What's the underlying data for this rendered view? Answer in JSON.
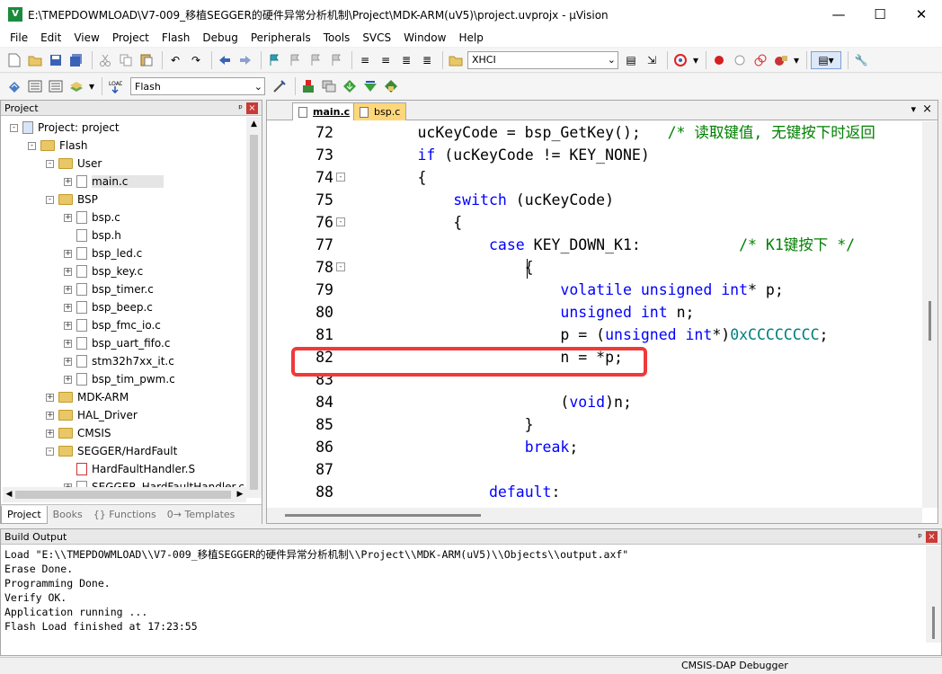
{
  "window": {
    "title": "E:\\TMEPDOWMLOAD\\V7-009_移植SEGGER的硬件异常分析机制\\Project\\MDK-ARM(uV5)\\project.uvprojx - µVision",
    "min": "—",
    "max": "☐",
    "close": "✕"
  },
  "menu": [
    "File",
    "Edit",
    "View",
    "Project",
    "Flash",
    "Debug",
    "Peripherals",
    "Tools",
    "SVCS",
    "Window",
    "Help"
  ],
  "toolbar": {
    "find_combo": "XHCI",
    "target_combo": "Flash"
  },
  "project_panel": {
    "title": "Project",
    "pin": "ᵖ",
    "close": "×",
    "tree": [
      {
        "label": "Project: project",
        "level": 0,
        "type": "root",
        "exp": "-"
      },
      {
        "label": "Flash",
        "level": 1,
        "type": "target",
        "exp": "-"
      },
      {
        "label": "User",
        "level": 2,
        "type": "folder",
        "exp": "-"
      },
      {
        "label": "main.c",
        "level": 3,
        "type": "file",
        "exp": "+"
      },
      {
        "label": "BSP",
        "level": 2,
        "type": "folder",
        "exp": "-"
      },
      {
        "label": "bsp.c",
        "level": 3,
        "type": "file",
        "exp": "+"
      },
      {
        "label": "bsp.h",
        "level": 3,
        "type": "file",
        "exp": ""
      },
      {
        "label": "bsp_led.c",
        "level": 3,
        "type": "file",
        "exp": "+"
      },
      {
        "label": "bsp_key.c",
        "level": 3,
        "type": "file",
        "exp": "+"
      },
      {
        "label": "bsp_timer.c",
        "level": 3,
        "type": "file",
        "exp": "+"
      },
      {
        "label": "bsp_beep.c",
        "level": 3,
        "type": "file",
        "exp": "+"
      },
      {
        "label": "bsp_fmc_io.c",
        "level": 3,
        "type": "file",
        "exp": "+"
      },
      {
        "label": "bsp_uart_fifo.c",
        "level": 3,
        "type": "file",
        "exp": "+"
      },
      {
        "label": "stm32h7xx_it.c",
        "level": 3,
        "type": "file",
        "exp": "+"
      },
      {
        "label": "bsp_tim_pwm.c",
        "level": 3,
        "type": "file",
        "exp": "+"
      },
      {
        "label": "MDK-ARM",
        "level": 2,
        "type": "folder",
        "exp": "+"
      },
      {
        "label": "HAL_Driver",
        "level": 2,
        "type": "folder",
        "exp": "+"
      },
      {
        "label": "CMSIS",
        "level": 2,
        "type": "folder",
        "exp": "+"
      },
      {
        "label": "SEGGER/HardFault",
        "level": 2,
        "type": "folder",
        "exp": "-"
      },
      {
        "label": "HardFaultHandler.S",
        "level": 3,
        "type": "asm",
        "exp": ""
      },
      {
        "label": "SEGGER_HardFaultHandler.c",
        "level": 3,
        "type": "file",
        "exp": "+"
      }
    ],
    "tabs": [
      "Project",
      "Books",
      "{} Functions",
      "0→ Templates"
    ]
  },
  "editor": {
    "tabs": [
      "main.c",
      "bsp.c"
    ],
    "active_tab": "main.c",
    "lines": [
      {
        "n": "72",
        "fold": "",
        "segs": [
          [
            "        ucKeyCode = bsp_GetKey();   ",
            ""
          ],
          [
            "/* 读取键值, 无键按下时返回",
            "cm"
          ]
        ]
      },
      {
        "n": "73",
        "fold": "",
        "segs": [
          [
            "        ",
            ""
          ],
          [
            "if",
            "kw"
          ],
          [
            " (ucKeyCode != KEY_NONE)",
            ""
          ]
        ]
      },
      {
        "n": "74",
        "fold": "-",
        "segs": [
          [
            "        {",
            ""
          ]
        ]
      },
      {
        "n": "75",
        "fold": "",
        "segs": [
          [
            "            ",
            ""
          ],
          [
            "switch",
            "kw"
          ],
          [
            " (ucKeyCode)",
            ""
          ]
        ]
      },
      {
        "n": "76",
        "fold": "-",
        "segs": [
          [
            "            {",
            ""
          ]
        ]
      },
      {
        "n": "77",
        "fold": "",
        "segs": [
          [
            "                ",
            ""
          ],
          [
            "case",
            "kw"
          ],
          [
            " KEY_DOWN_K1:           ",
            ""
          ],
          [
            "/* K1键按下 */",
            "cm"
          ]
        ]
      },
      {
        "n": "78",
        "fold": "-",
        "segs": [
          [
            "                    {",
            ""
          ]
        ]
      },
      {
        "n": "79",
        "fold": "",
        "segs": [
          [
            "                        ",
            ""
          ],
          [
            "volatile unsigned int",
            "kw"
          ],
          [
            "* p;",
            ""
          ]
        ]
      },
      {
        "n": "80",
        "fold": "",
        "segs": [
          [
            "                        ",
            ""
          ],
          [
            "unsigned int",
            "kw"
          ],
          [
            " n;",
            ""
          ]
        ]
      },
      {
        "n": "81",
        "fold": "",
        "segs": [
          [
            "                        p = (",
            ""
          ],
          [
            "unsigned int",
            "kw"
          ],
          [
            "*)",
            ""
          ],
          [
            "0xCCCCCCCC",
            "nm"
          ],
          [
            ";",
            ""
          ]
        ]
      },
      {
        "n": "82",
        "fold": "",
        "segs": [
          [
            "                        n = *p;",
            ""
          ]
        ]
      },
      {
        "n": "83",
        "fold": "",
        "segs": [
          [
            "",
            ""
          ]
        ]
      },
      {
        "n": "84",
        "fold": "",
        "segs": [
          [
            "                        (",
            ""
          ],
          [
            "void",
            "kw"
          ],
          [
            ")n;",
            ""
          ]
        ]
      },
      {
        "n": "85",
        "fold": "",
        "segs": [
          [
            "                    }",
            ""
          ]
        ]
      },
      {
        "n": "86",
        "fold": "",
        "segs": [
          [
            "                    ",
            ""
          ],
          [
            "break",
            "kw"
          ],
          [
            ";",
            ""
          ]
        ]
      },
      {
        "n": "87",
        "fold": "",
        "segs": [
          [
            "",
            ""
          ]
        ]
      },
      {
        "n": "88",
        "fold": "",
        "segs": [
          [
            "                ",
            ""
          ],
          [
            "default",
            "kw"
          ],
          [
            ":",
            ""
          ]
        ]
      }
    ]
  },
  "build_output": {
    "title": "Build Output",
    "lines": [
      "Load \"E:\\\\TMEPDOWMLOAD\\\\V7-009_移植SEGGER的硬件异常分析机制\\\\Project\\\\MDK-ARM(uV5)\\\\Objects\\\\output.axf\"",
      "Erase Done.",
      "Programming Done.",
      "Verify OK.",
      "Application running ...",
      "Flash Load finished at 17:23:55"
    ]
  },
  "status": {
    "debugger": "CMSIS-DAP Debugger"
  },
  "colors": {
    "keyword": "#0000ff",
    "comment": "#008000",
    "number": "#008080",
    "highlight": "#ef3a3a"
  }
}
